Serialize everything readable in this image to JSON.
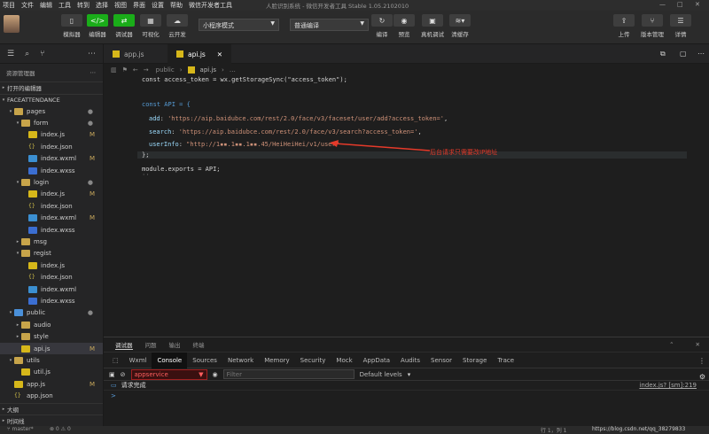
{
  "menu": [
    "项目",
    "文件",
    "编辑",
    "工具",
    "转到",
    "选择",
    "视图",
    "界面",
    "设置",
    "帮助",
    "微信开发者工具"
  ],
  "window_title": "人脸识别系统 - 微信开发者工具 Stable 1.05.2102010",
  "toolbar": {
    "simulator": "模拟器",
    "editor": "编辑器",
    "debugger": "调试器",
    "visualize": "可视化",
    "cloud": "云开发",
    "mode_select": "小程序模式",
    "compile_select": "普通编译",
    "compile": "编译",
    "preview": "预览",
    "real_debug": "真机调试",
    "clear_cache": "清缓存",
    "upload": "上传",
    "version": "版本管理",
    "details": "详情"
  },
  "sidebar": {
    "title": "资源管理器",
    "open_editors": "打开的编辑器",
    "project": "FACEATTENDANCE",
    "items": [
      {
        "label": "pages",
        "depth": 1,
        "type": "folder",
        "arrow": "▾",
        "mark": "●"
      },
      {
        "label": "form",
        "depth": 2,
        "type": "folder",
        "arrow": "▾",
        "mark": "●"
      },
      {
        "label": "index.js",
        "depth": 3,
        "type": "js",
        "mark": "M"
      },
      {
        "label": "index.json",
        "depth": 3,
        "type": "json",
        "mark": ""
      },
      {
        "label": "index.wxml",
        "depth": 3,
        "type": "wxml",
        "mark": "M"
      },
      {
        "label": "index.wxss",
        "depth": 3,
        "type": "wxss",
        "mark": ""
      },
      {
        "label": "login",
        "depth": 2,
        "type": "folder",
        "arrow": "▾",
        "mark": "●"
      },
      {
        "label": "index.js",
        "depth": 3,
        "type": "js",
        "mark": "M"
      },
      {
        "label": "index.json",
        "depth": 3,
        "type": "json",
        "mark": ""
      },
      {
        "label": "index.wxml",
        "depth": 3,
        "type": "wxml",
        "mark": "M"
      },
      {
        "label": "index.wxss",
        "depth": 3,
        "type": "wxss",
        "mark": ""
      },
      {
        "label": "msg",
        "depth": 2,
        "type": "folder",
        "arrow": "▸",
        "mark": ""
      },
      {
        "label": "regist",
        "depth": 2,
        "type": "folder",
        "arrow": "▾",
        "mark": ""
      },
      {
        "label": "index.js",
        "depth": 3,
        "type": "js",
        "mark": ""
      },
      {
        "label": "index.json",
        "depth": 3,
        "type": "json",
        "mark": ""
      },
      {
        "label": "index.wxml",
        "depth": 3,
        "type": "wxml",
        "mark": ""
      },
      {
        "label": "index.wxss",
        "depth": 3,
        "type": "wxss",
        "mark": ""
      },
      {
        "label": "public",
        "depth": 1,
        "type": "pub",
        "arrow": "▾",
        "mark": "●"
      },
      {
        "label": "audio",
        "depth": 2,
        "type": "folder",
        "arrow": "▸",
        "mark": ""
      },
      {
        "label": "style",
        "depth": 2,
        "type": "folder",
        "arrow": "▸",
        "mark": ""
      },
      {
        "label": "api.js",
        "depth": 2,
        "type": "js",
        "mark": "M",
        "selected": true
      },
      {
        "label": "utils",
        "depth": 1,
        "type": "folder",
        "arrow": "▾",
        "mark": ""
      },
      {
        "label": "util.js",
        "depth": 2,
        "type": "js",
        "mark": ""
      },
      {
        "label": "app.js",
        "depth": 1,
        "type": "js",
        "mark": "M"
      },
      {
        "label": "app.json",
        "depth": 1,
        "type": "json",
        "mark": ""
      }
    ],
    "outline": "大纲",
    "timeline": "时间线"
  },
  "tabs": [
    {
      "label": "app.js"
    },
    {
      "label": "api.js",
      "active": true
    }
  ],
  "breadcrumb": {
    "folder": "public",
    "file": "api.js"
  },
  "code": {
    "l1": "const access_token = wx.getStorageSync(\"access_token\");",
    "l2": "const API = {",
    "l3_key": "add",
    "l3_val": "'https://aip.baidubce.com/rest/2.0/face/v3/faceset/user/add?access_token='",
    "l4_key": "search",
    "l4_val": "'https://aip.baidubce.com/rest/2.0/face/v3/search?access_token='",
    "l5_key": "userInfo",
    "l5_val": "\"http://1▪▪.1▪▪.1▪▪.45/HeiHeiHei/v1/user\"",
    "l6": "};",
    "l7": "module.exports = API;",
    "annotation": "后台请求只需要改IP地址"
  },
  "console": {
    "tabs": [
      "调试器",
      "问题",
      "输出",
      "终端"
    ],
    "devtabs": [
      "Wxml",
      "Console",
      "Sources",
      "Network",
      "Memory",
      "Security",
      "Mock",
      "AppData",
      "Audits",
      "Sensor",
      "Storage",
      "Trace"
    ],
    "context": "appservice",
    "filter_placeholder": "Filter",
    "levels": "Default levels",
    "log_text": "请求完成",
    "log_source": "index.js? [sm]:219",
    "prompt": ">"
  },
  "status": {
    "branch": "master*",
    "errors": "⊗ 0 ⚠ 0",
    "position": "行 1，列 1",
    "watermark": "https://blog.csdn.net/qq_38279833"
  }
}
